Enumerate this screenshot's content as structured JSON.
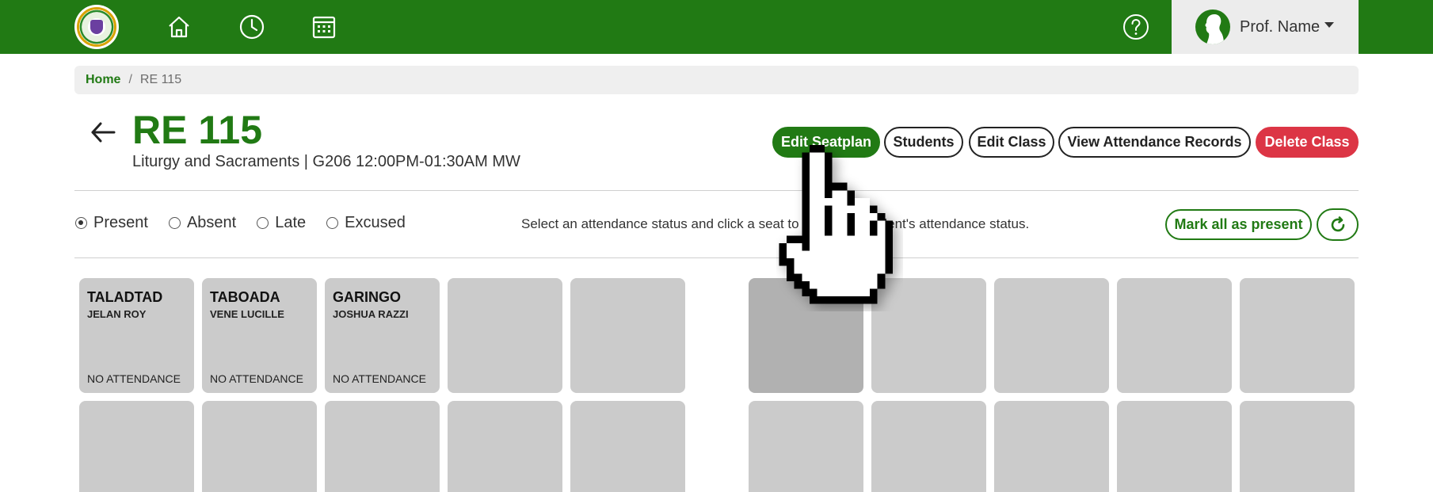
{
  "app": {
    "profile_name": "Prof. Name",
    "nav_icons": [
      "home-icon",
      "clock-icon",
      "calendar-icon"
    ],
    "help_icon": "help-icon"
  },
  "breadcrumb": {
    "home": "Home",
    "separator": "/",
    "current": "RE 115"
  },
  "header": {
    "class_code": "RE 115",
    "subtitle": "Liturgy and Sacraments | G206 12:00PM-01:30AM MW"
  },
  "actions": {
    "edit_seatplan": "Edit Seatplan",
    "students": "Students",
    "edit_class": "Edit Class",
    "view_attendance": "View Attendance Records",
    "delete_class": "Delete Class"
  },
  "status_options": [
    {
      "label": "Present",
      "checked": true
    },
    {
      "label": "Absent",
      "checked": false
    },
    {
      "label": "Late",
      "checked": false
    },
    {
      "label": "Excused",
      "checked": false
    }
  ],
  "instruction": "Select an attendance status and click a seat to change a student's attendance status.",
  "mark_all_label": "Mark all as present",
  "seats": [
    {
      "last": "TALADTAD",
      "first": "JELAN ROY",
      "status": "NO ATTENDANCE"
    },
    {
      "last": "TABOADA",
      "first": "VENE LUCILLE",
      "status": "NO ATTENDANCE"
    },
    {
      "last": "GARINGO",
      "first": "JOSHUA RAZZI",
      "status": "NO ATTENDANCE"
    }
  ],
  "colors": {
    "brand": "#217a14",
    "danger": "#dc3545",
    "seat": "#cbcbcb",
    "seat_hover": "#b1b1b1"
  }
}
